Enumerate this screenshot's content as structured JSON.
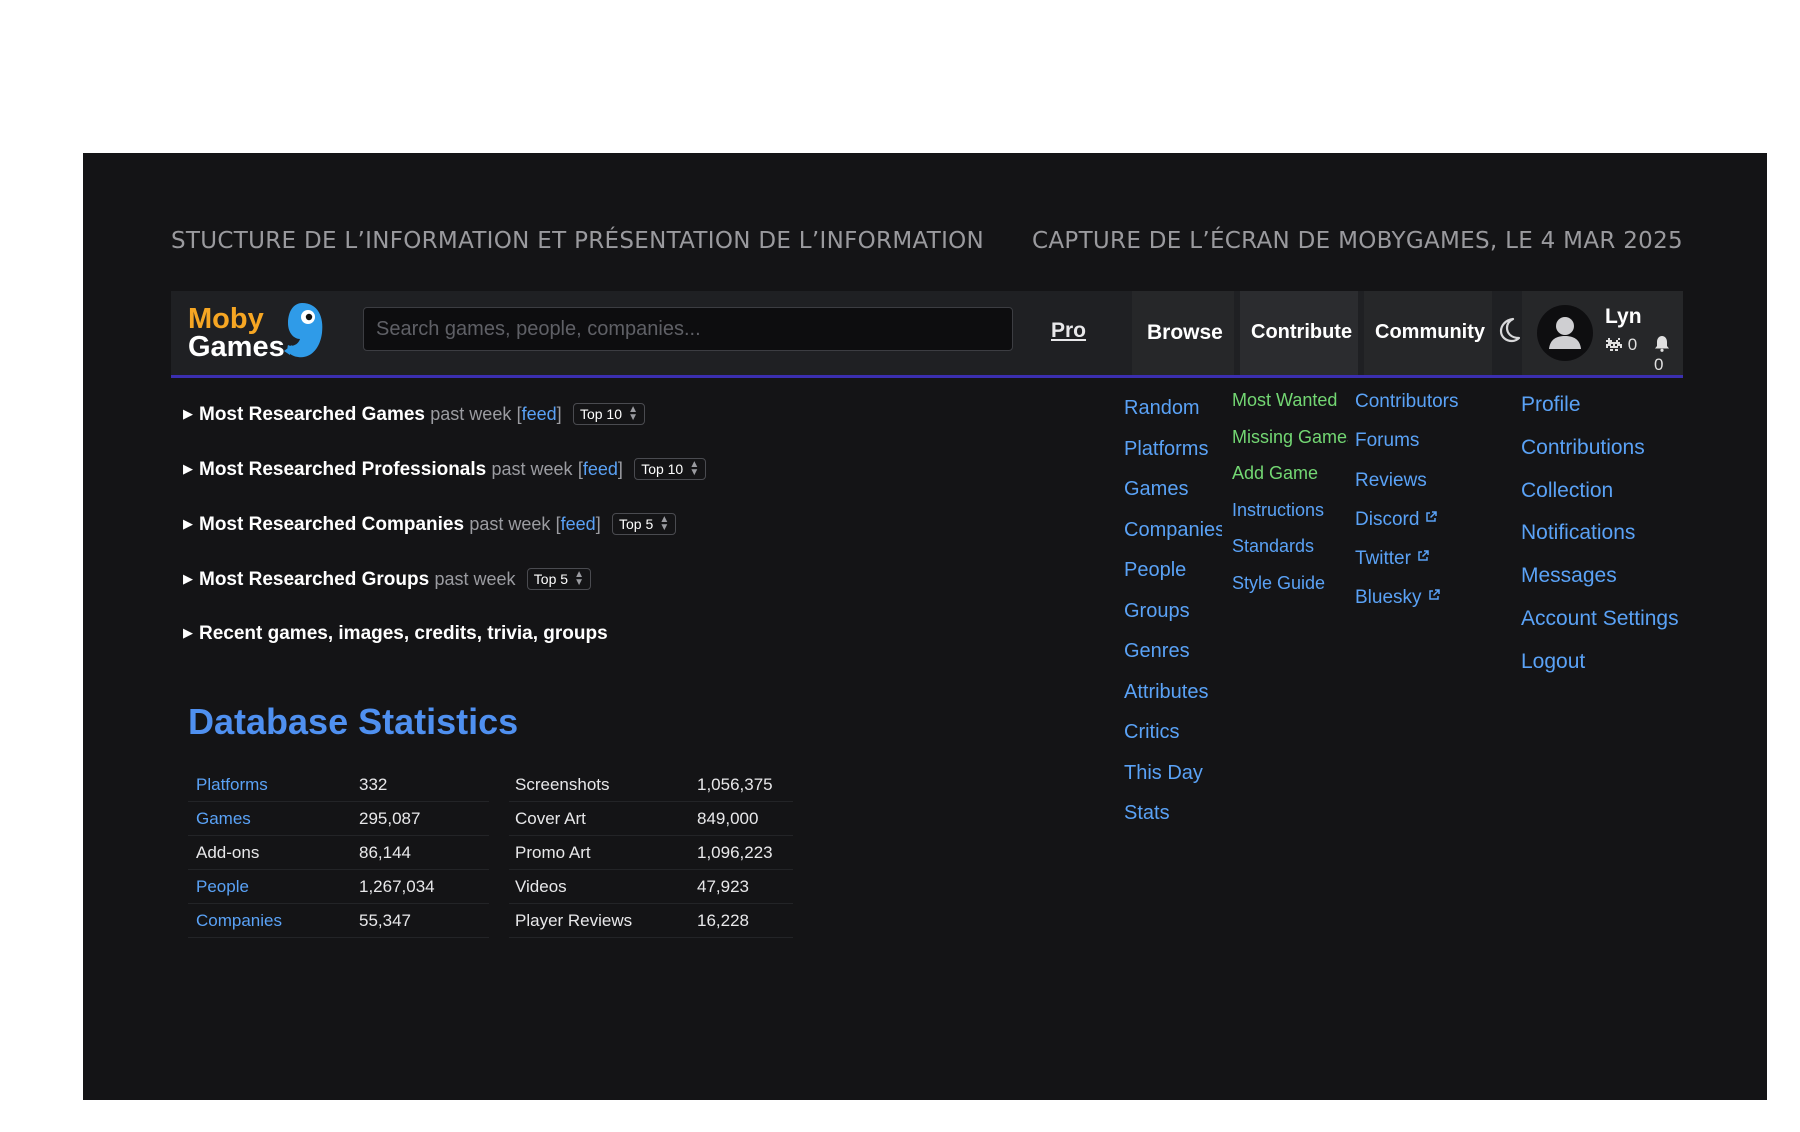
{
  "slide": {
    "title_left": "STUCTURE DE L’INFORMATION ET  PRÉSENTATION DE L’INFORMATION",
    "title_right": "CAPTURE DE L’ÉCRAN DE MOBYGAMES, LE 4 MAR 2025"
  },
  "logo": {
    "line1": "Moby",
    "line2": "Games"
  },
  "search": {
    "placeholder": "Search games, people, companies..."
  },
  "nav": {
    "pro": "Pro",
    "browse": "Browse",
    "contribute": "Contribute",
    "community": "Community",
    "theme_icon": "moon-icon"
  },
  "user": {
    "name": "Lyn",
    "badge_count": "0",
    "notification_count": "0"
  },
  "menus": {
    "browse": [
      "Random",
      "Platforms",
      "Games",
      "Companies",
      "People",
      "Groups",
      "Genres",
      "Attributes",
      "Critics",
      "This Day",
      "Stats"
    ],
    "contribute": [
      "Most Wanted",
      "Missing Games",
      "Add Game",
      "Instructions",
      "Standards",
      "Style Guide"
    ],
    "community": [
      "Contributors",
      "Forums",
      "Reviews",
      "Discord",
      "Twitter",
      "Bluesky"
    ],
    "user": [
      "Profile",
      "Contributions",
      "Collection",
      "Notifications",
      "Messages",
      "Account Settings",
      "Logout"
    ]
  },
  "sections": [
    {
      "title": "Most Researched Games",
      "period": "past week",
      "feed": "feed",
      "select": "Top 10"
    },
    {
      "title": "Most Researched Professionals",
      "period": "past week",
      "feed": "feed",
      "select": "Top 10"
    },
    {
      "title": "Most Researched Companies",
      "period": "past week",
      "feed": "feed",
      "select": "Top 5"
    },
    {
      "title": "Most Researched Groups",
      "period": "past week",
      "select": "Top 5"
    },
    {
      "title": "Recent games, images, credits, trivia, groups"
    }
  ],
  "database": {
    "title": "Database Statistics",
    "rows": [
      {
        "label1": "Platforms",
        "value1": "332",
        "label2": "Screenshots",
        "value2": "1,056,375"
      },
      {
        "label1": "Games",
        "value1": "295,087",
        "label2": "Cover Art",
        "value2": "849,000"
      },
      {
        "label1": "Add-ons",
        "value1": "86,144",
        "label2": "Promo Art",
        "value2": "1,096,223"
      },
      {
        "label1": "People",
        "value1": "1,267,034",
        "label2": "Videos",
        "value2": "47,923"
      },
      {
        "label1": "Companies",
        "value1": "55,347",
        "label2": "Player Reviews",
        "value2": "16,228"
      }
    ]
  },
  "colors": {
    "background": "#141416",
    "navbar": "#1f2023",
    "link": "#5aa2f6",
    "contribute_highlight": "#73d773",
    "heading": "#4f90f0",
    "logo_orange": "#f6a623",
    "navbar_underline": "#3b2fb0"
  }
}
